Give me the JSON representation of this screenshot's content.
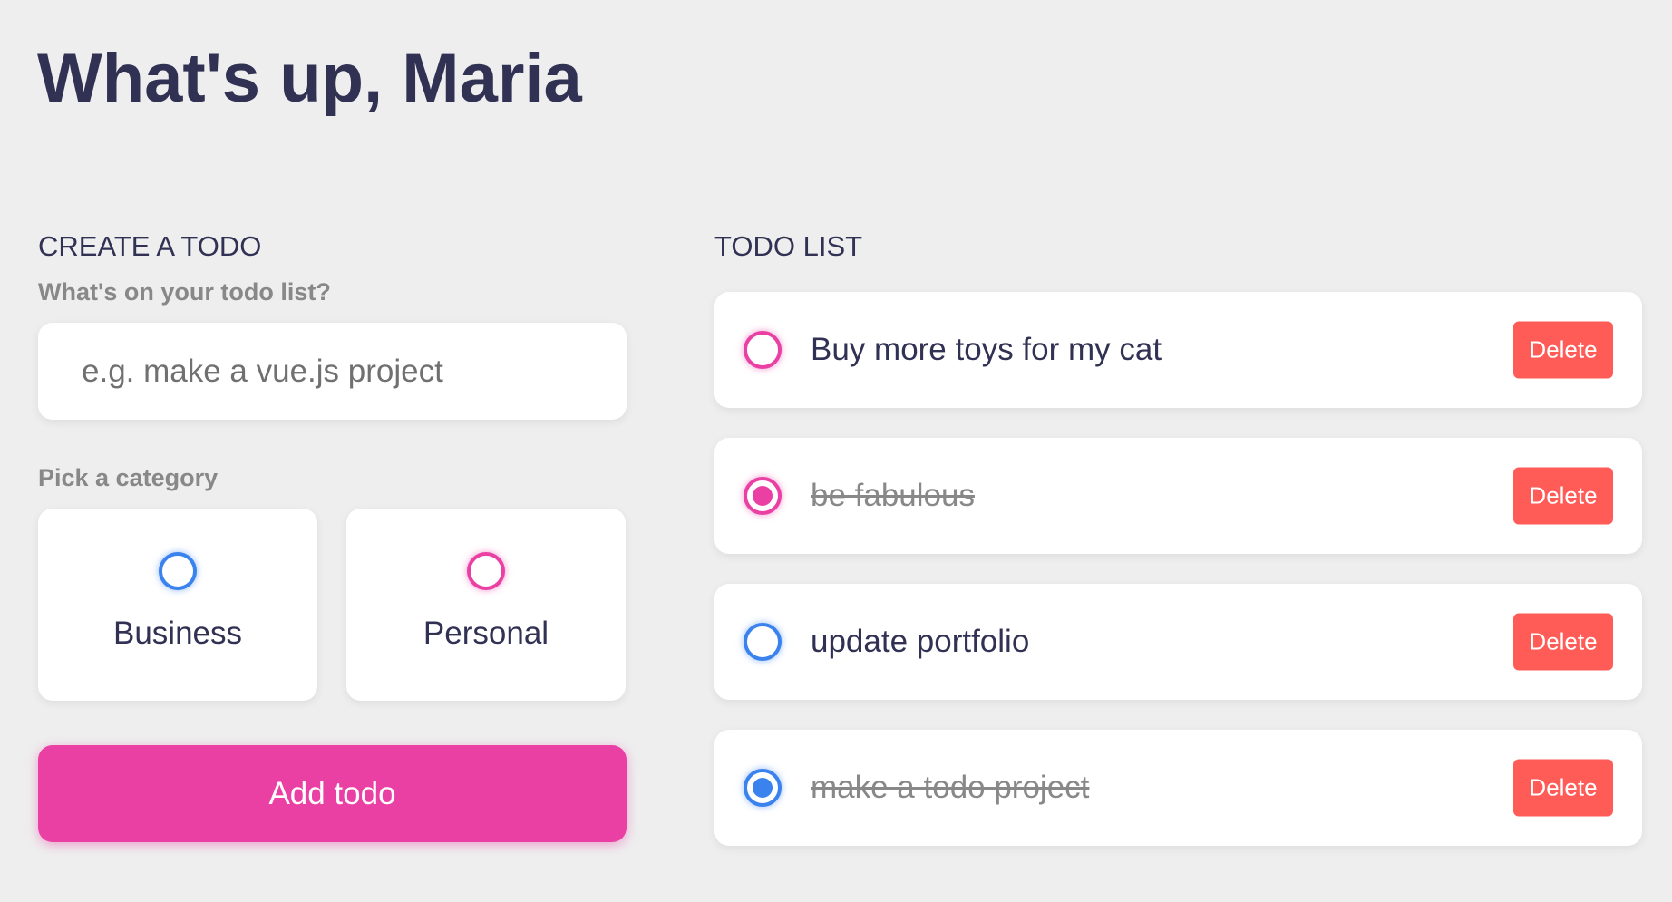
{
  "header": {
    "greeting": "What's up, Maria"
  },
  "create": {
    "title": "CREATE A TODO",
    "todo_label": "What's on your todo list?",
    "todo_placeholder": "e.g. make a vue.js project",
    "category_label": "Pick a category",
    "categories": [
      {
        "label": "Business",
        "color": "#3A82EE",
        "selected": false
      },
      {
        "label": "Personal",
        "color": "#EA40A4",
        "selected": false
      }
    ],
    "add_button_label": "Add todo"
  },
  "list": {
    "title": "TODO LIST",
    "items": [
      {
        "text": "Buy more toys for my cat",
        "category": "Personal",
        "done": false,
        "delete_label": "Delete"
      },
      {
        "text": "be fabulous",
        "category": "Personal",
        "done": true,
        "delete_label": "Delete"
      },
      {
        "text": "update portfolio",
        "category": "Business",
        "done": false,
        "delete_label": "Delete"
      },
      {
        "text": "make a todo project",
        "category": "Business",
        "done": true,
        "delete_label": "Delete"
      }
    ]
  },
  "colors": {
    "background": "#EEEEEE",
    "text_primary": "#313154",
    "text_muted": "#888888",
    "business": "#3A82EE",
    "personal": "#EA40A4",
    "delete": "#FF5B57"
  }
}
